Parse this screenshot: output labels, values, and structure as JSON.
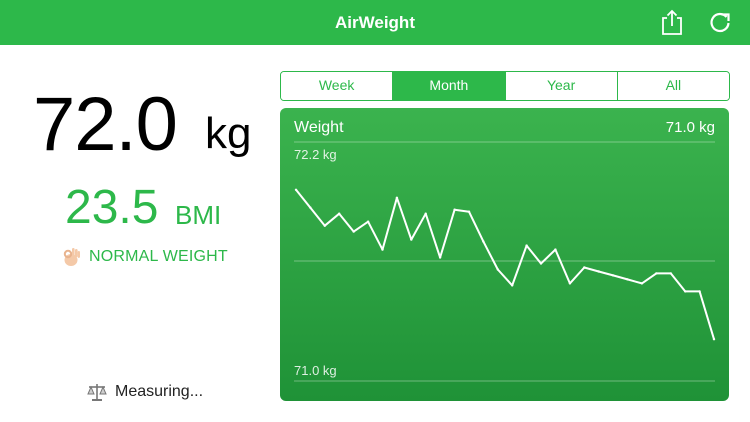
{
  "app": {
    "title": "AirWeight"
  },
  "navbar": {
    "share_icon": "share-icon",
    "refresh_icon": "refresh-icon"
  },
  "summary": {
    "weight_value": "72.0",
    "weight_unit": "kg",
    "bmi_value": "23.5",
    "bmi_unit": "BMI",
    "status_label": "NORMAL WEIGHT",
    "status_icon": "ok-hand-icon",
    "measuring_label": "Measuring...",
    "measuring_icon": "scale-icon",
    "accent_color": "#2db84a"
  },
  "range_tabs": {
    "items": [
      "Week",
      "Month",
      "Year",
      "All"
    ],
    "selected": "Month"
  },
  "chart": {
    "title": "Weight",
    "latest_label": "71.0 kg",
    "top_tick": "72.2 kg",
    "bottom_tick": "71.0 kg"
  },
  "chart_data": {
    "type": "line",
    "title": "Weight",
    "ylabel": "",
    "xlabel": "",
    "ylim": [
      71.0,
      72.2
    ],
    "y_tick_labels": [
      "72.2 kg",
      "71.0 kg"
    ],
    "grid": true,
    "series": [
      {
        "values": [
          71.96,
          71.87,
          71.78,
          71.84,
          71.75,
          71.8,
          71.66,
          71.92,
          71.71,
          71.84,
          71.62,
          71.86,
          71.85,
          71.7,
          71.56,
          71.48,
          71.68,
          71.59,
          71.66,
          71.49,
          71.57,
          71.55,
          71.53,
          71.51,
          71.49,
          71.54,
          71.54,
          71.45,
          71.45,
          71.21
        ]
      }
    ]
  }
}
